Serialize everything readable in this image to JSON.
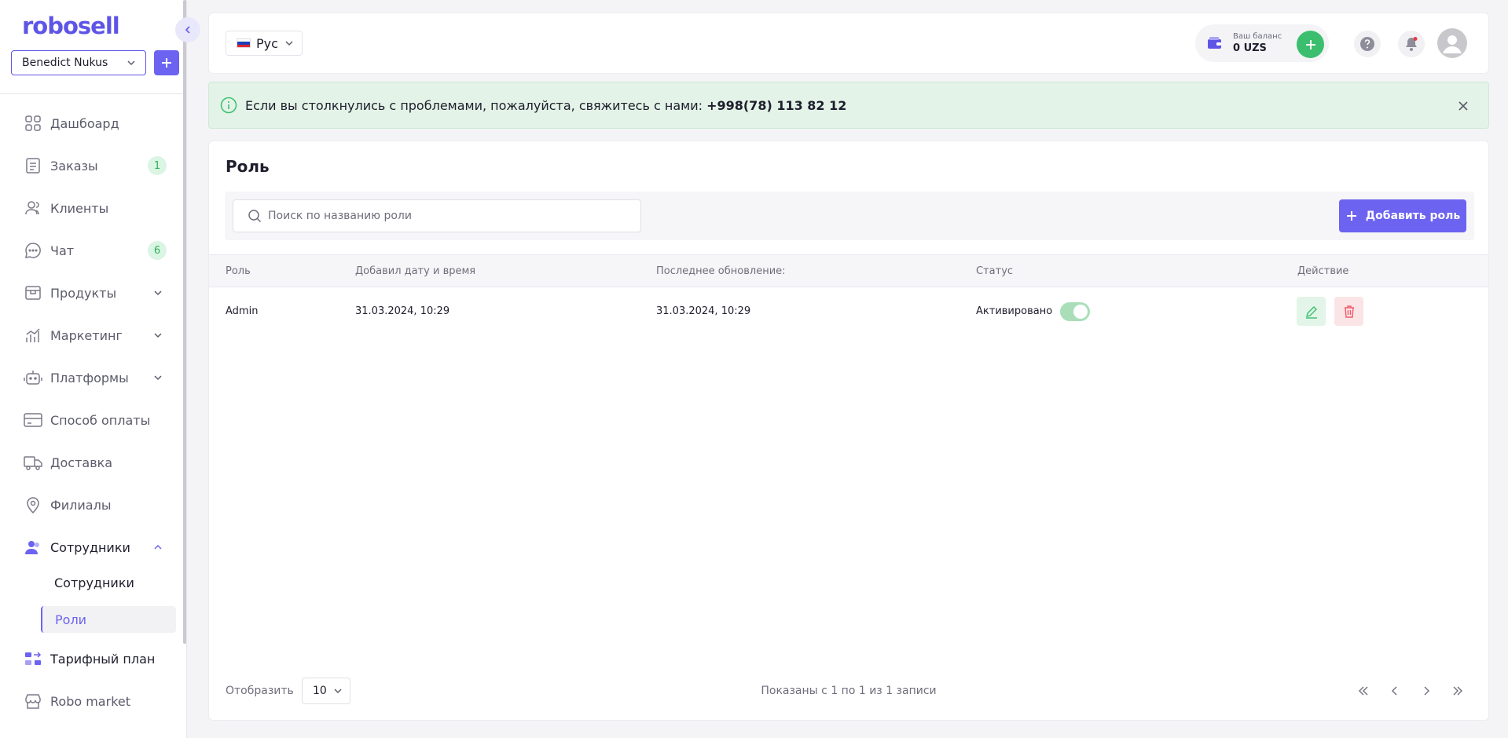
{
  "brand": {
    "name": "robosell",
    "color": "#5e55e6"
  },
  "store": {
    "selected": "Benedict Nukus"
  },
  "sidebar": {
    "items": [
      {
        "label": "Дашбоард",
        "icon": "grid-icon"
      },
      {
        "label": "Заказы",
        "icon": "clipboard-icon",
        "badge": "1"
      },
      {
        "label": "Клиенты",
        "icon": "users-icon"
      },
      {
        "label": "Чат",
        "icon": "chat-icon",
        "badge": "6"
      },
      {
        "label": "Продукты",
        "icon": "box-icon"
      },
      {
        "label": "Маркетинг",
        "icon": "chart-icon"
      },
      {
        "label": "Платформы",
        "icon": "robot-icon"
      },
      {
        "label": "Способ оплаты",
        "icon": "card-icon"
      },
      {
        "label": "Доставка",
        "icon": "truck-icon"
      },
      {
        "label": "Филиалы",
        "icon": "location-icon"
      },
      {
        "label": "Сотрудники",
        "icon": "team-icon"
      },
      {
        "label": "Тарифный план",
        "icon": "plan-icon"
      },
      {
        "label": "Robo market",
        "icon": "shop-icon"
      }
    ],
    "sub_items": [
      {
        "label": "Сотрудники"
      },
      {
        "label": "Роли"
      }
    ]
  },
  "topbar": {
    "language": "Рус",
    "balance_label": "Ваш баланс",
    "balance_value": "0 UZS"
  },
  "alert": {
    "text": "Если вы столкнулись с проблемами, пожалуйста, свяжитесь с нами: ",
    "phone": "+998(78) 113 82 12"
  },
  "page": {
    "title": "Роль",
    "search_placeholder": "Поиск по названию роли",
    "add_button": "Добавить роль"
  },
  "table": {
    "headers": [
      "Роль",
      "Добавил дату и время",
      "Последнее обновление:",
      "Статус",
      "Действие"
    ],
    "rows": [
      {
        "role": "Admin",
        "created": "31.03.2024, 10:29",
        "updated": "31.03.2024, 10:29",
        "status": "Активировано",
        "active": true
      }
    ]
  },
  "footer": {
    "show_label": "Отобразить",
    "per_page": "10",
    "info": "Показаны с 1 по 1 из 1 записи"
  },
  "colors": {
    "accent": "#6c63f0",
    "success": "#3bbf6e",
    "danger": "#ef5a6a"
  }
}
